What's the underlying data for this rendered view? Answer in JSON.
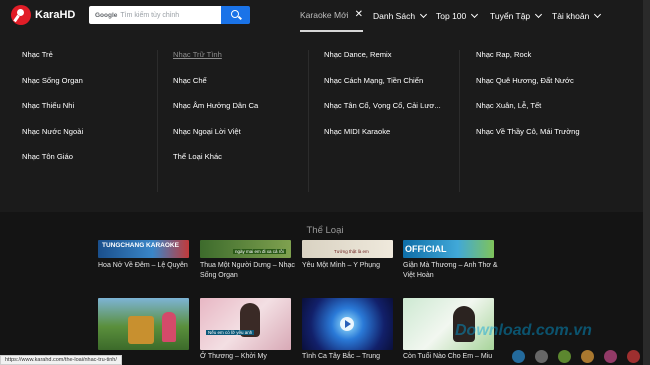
{
  "brand": {
    "name": "KaraHD"
  },
  "search": {
    "brand_word": "Google",
    "placeholder": "Tìm kiếm tùy chỉnh"
  },
  "nav": {
    "active": "Karaoke Mới",
    "items": [
      "Danh Sách",
      "Top 100",
      "Tuyển Tập",
      "Tài khoản"
    ]
  },
  "menu": {
    "col1": [
      "Nhạc Trẻ",
      "Nhạc Sống Organ",
      "Nhạc Thiếu Nhi",
      "Nhạc Nước Ngoài",
      "Nhạc Tôn Giáo"
    ],
    "col2": [
      "Nhạc Trữ Tình",
      "Nhạc Chế",
      "Nhạc Âm Hưởng Dân Ca",
      "Nhạc Ngoại Lời Việt",
      "Thể Loại Khác"
    ],
    "col3": [
      "Nhạc Dance, Remix",
      "Nhạc Cách Mạng, Tiền Chiến",
      "Nhạc Tân Cổ, Vọng Cổ, Cải Lươ...",
      "Nhạc MIDI Karaoke"
    ],
    "col4": [
      "Nhạc Rap, Rock",
      "Nhạc Quê Hương, Đất Nước",
      "Nhạc Xuân, Lễ, Tết",
      "Nhạc Về Thầy Cô, Mái Trường"
    ]
  },
  "section": {
    "title": "Thể Loại"
  },
  "videos_row1": [
    {
      "caption": "Hoa Nở Về Đêm – Lệ Quyên",
      "thumb_text": "TUNGCHANG KARAOKE"
    },
    {
      "caption": "Thua Một Người Dưng – Nhạc Sống Organ",
      "thumb_text": "ngày mai em đi xa cả rồi"
    },
    {
      "caption": "Yêu Một Mình – Y Phụng",
      "thumb_text": "Tưởng thật là em"
    },
    {
      "caption": "Giận Mà Thương – Anh Thơ & Việt Hoàn",
      "thumb_text": "OFFICIAL"
    }
  ],
  "videos_row2": [
    {
      "caption": "",
      "thumb_text": ""
    },
    {
      "caption": "Ở Thương – Khởi My",
      "thumb_text": "Nếu em có lỡ yêu anh"
    },
    {
      "caption": "Tình Ca Tây Bắc – Trung",
      "thumb_text": ""
    },
    {
      "caption": "Còn Tuổi Nào Cho Em – Miu",
      "thumb_text": ""
    }
  ],
  "status_url": "https://www.karahd.com/the-loai/nhac-tru-tinh/",
  "watermark": "Download.com.vn",
  "colors": {
    "accent": "#1a73e8",
    "brand": "#e11d27",
    "bg": "#1b1b1b"
  }
}
